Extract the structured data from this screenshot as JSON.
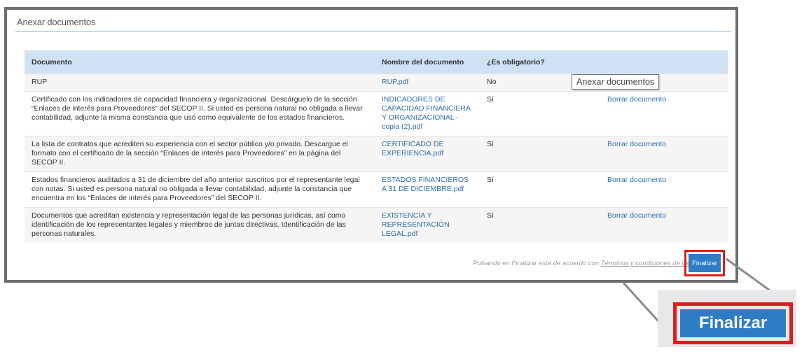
{
  "section": {
    "title": "Anexar documentos"
  },
  "table": {
    "headers": [
      "Documento",
      "Nombre del documento",
      "¿Es obligatorio?",
      ""
    ],
    "rows": [
      {
        "document": "RUP",
        "file": "RUP.pdf",
        "required": "No",
        "action": ""
      },
      {
        "document": "Certificado con los indicadores de capacidad financiera y organizacional. Descárguelo de la sección “Enlaces de interés para Proveedores” del SECOP II. Si usted es persona natural no obligada a llevar contabilidad, adjunte la misma constancia que usó como equivalente de los estados financieros.",
        "file": "INDICADORES DE CAPACIDAD FINANCIERA Y ORGANIZACIONAL - copia (2).pdf",
        "required": "Sí",
        "action": "Borrar documento"
      },
      {
        "document": "La lista de contratos que acrediten su experiencia con el sector público y/o privado. Descargue el formato con el certificado de la sección “Enlaces de interés para Proveedores” en la página del SECOP II.",
        "file": "CERTIFICADO DE EXPERIENCIA.pdf",
        "required": "Sí",
        "action": "Borrar documento"
      },
      {
        "document": "Estados financieros auditados a 31 de diciembre del año anterior suscritos por el representante legal con notas. Si usted es persona natural no obligada a llevar contabilidad, adjunte la constancia que encuentra en los “Enlaces de interés para Proveedores” del SECOP II.",
        "file": "ESTADOS FINANCIEROS A 31 DE DICIEMBRE.pdf",
        "required": "Sí",
        "action": "Borrar documento"
      },
      {
        "document": "Documentos que acreditan existencia y representación legal de las personas jurídicas, así como identificación de los representantes legales y miembros de juntas directivas. Identificación de las personas naturales.",
        "file": "EXISTENCIA Y REPRESENTACIÓN LEGAL.pdf",
        "required": "Sí",
        "action": "Borrar documento"
      }
    ]
  },
  "tooltip": {
    "text": "Anexar documentos"
  },
  "footer": {
    "terms_prefix": "Pulsando en Finalizar está de acuerdo con ",
    "terms_link": "Términos y condiciones de uso",
    "finalize_label": "Finalizar"
  },
  "zoom": {
    "finalize_label": "Finalizar"
  },
  "colors": {
    "accent": "#2e7cc4",
    "highlight": "#e01b1b",
    "header_bg": "#cfe2f3",
    "link": "#2f6fad"
  }
}
